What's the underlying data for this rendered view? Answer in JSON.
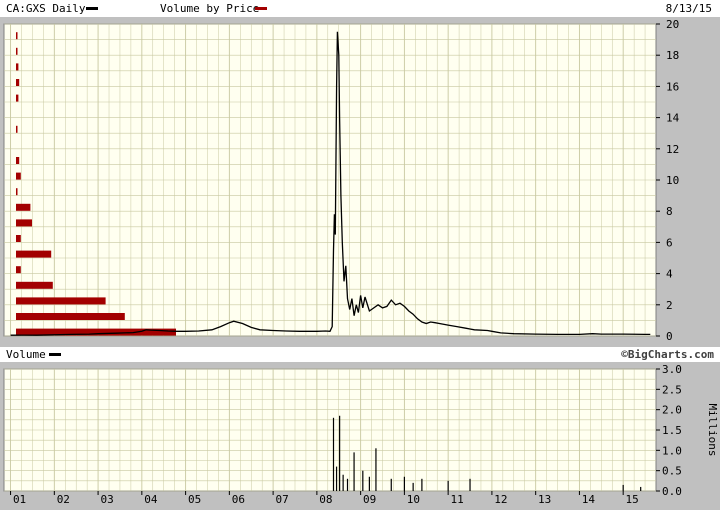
{
  "header": {
    "symbol_label": "CA:GXS Daily",
    "vbp_label": "Volume by Price",
    "date": "8/13/15"
  },
  "volume_header": {
    "label": "Volume",
    "watermark": "©BigCharts.com"
  },
  "colors": {
    "plot_bg": "#fffff0",
    "grid": "#c8c8a0",
    "frame_bg": "#c0c0c0",
    "price_line": "#000000",
    "vbp_bar": "#a30000"
  },
  "chart_data": [
    {
      "type": "line",
      "series": [
        {
          "name": "CA:GXS Daily",
          "x": [
            2001.0,
            2001.3,
            2001.6,
            2002.0,
            2002.4,
            2002.8,
            2003.0,
            2003.4,
            2003.6,
            2003.8,
            2004.0,
            2004.1,
            2004.2,
            2004.4,
            2004.6,
            2004.8,
            2005.0,
            2005.3,
            2005.6,
            2005.8,
            2006.0,
            2006.1,
            2006.3,
            2006.5,
            2006.7,
            2007.0,
            2007.3,
            2007.6,
            2008.0,
            2008.2,
            2008.3,
            2008.35,
            2008.38,
            2008.4,
            2008.42,
            2008.45,
            2008.47,
            2008.5,
            2008.52,
            2008.55,
            2008.58,
            2008.62,
            2008.66,
            2008.7,
            2008.75,
            2008.8,
            2008.85,
            2008.9,
            2008.95,
            2009.0,
            2009.05,
            2009.1,
            2009.2,
            2009.3,
            2009.4,
            2009.5,
            2009.6,
            2009.7,
            2009.8,
            2009.9,
            2010.0,
            2010.1,
            2010.2,
            2010.3,
            2010.4,
            2010.5,
            2010.6,
            2010.7,
            2010.8,
            2011.0,
            2011.2,
            2011.4,
            2011.5,
            2011.6,
            2011.9,
            2012.0,
            2012.2,
            2012.5,
            2013.0,
            2013.5,
            2014.0,
            2014.3,
            2014.5,
            2015.0,
            2015.5,
            2015.62
          ],
          "y": [
            0.05,
            0.06,
            0.05,
            0.08,
            0.1,
            0.12,
            0.15,
            0.18,
            0.2,
            0.22,
            0.3,
            0.4,
            0.38,
            0.35,
            0.32,
            0.3,
            0.3,
            0.32,
            0.4,
            0.6,
            0.85,
            0.95,
            0.8,
            0.55,
            0.4,
            0.35,
            0.32,
            0.3,
            0.3,
            0.32,
            0.3,
            0.6,
            5.5,
            7.8,
            6.5,
            16.0,
            19.5,
            18.0,
            14.0,
            9.0,
            6.0,
            3.5,
            4.5,
            2.4,
            1.7,
            2.4,
            1.3,
            2.0,
            1.5,
            2.6,
            1.8,
            2.5,
            1.6,
            1.8,
            2.0,
            1.8,
            1.9,
            2.3,
            2.0,
            2.1,
            1.9,
            1.6,
            1.4,
            1.1,
            0.9,
            0.8,
            0.9,
            0.85,
            0.8,
            0.7,
            0.6,
            0.5,
            0.45,
            0.4,
            0.35,
            0.3,
            0.2,
            0.15,
            0.12,
            0.1,
            0.1,
            0.15,
            0.12,
            0.12,
            0.1,
            0.1
          ]
        },
        {
          "name": "Volume by Price",
          "price_levels": [
            0.25,
            1.25,
            2.25,
            3.25,
            4.25,
            5.25,
            6.25,
            7.25,
            8.25,
            9.25,
            10.25,
            11.25,
            12.25,
            13.25,
            14.25,
            15.25,
            16.25,
            17.25,
            18.25,
            19.25
          ],
          "values": [
            100,
            68,
            56,
            23,
            3,
            22,
            3,
            10,
            9,
            0.8,
            3,
            2,
            0,
            0.8,
            0,
            1.5,
            2,
            1.5,
            0.5,
            0.8
          ]
        }
      ],
      "xaxis_ticks": [
        "01",
        "02",
        "03",
        "04",
        "05",
        "06",
        "07",
        "08",
        "09",
        "10",
        "11",
        "12",
        "13",
        "14",
        "15"
      ],
      "ylim": [
        0,
        20
      ],
      "yticks": [
        "0",
        "2",
        "4",
        "6",
        "8",
        "10",
        "12",
        "14",
        "16",
        "18",
        "20"
      ],
      "grid": true
    },
    {
      "type": "bar",
      "series": [
        {
          "name": "Volume",
          "x": [
            2008.38,
            2008.45,
            2008.52,
            2008.6,
            2008.7,
            2008.85,
            2009.05,
            2009.2,
            2009.35,
            2009.7,
            2010.0,
            2010.2,
            2010.4,
            2011.0,
            2011.5,
            2015.0,
            2015.4
          ],
          "y": [
            1.8,
            0.6,
            1.85,
            0.4,
            0.3,
            0.95,
            0.5,
            0.35,
            1.05,
            0.3,
            0.35,
            0.2,
            0.3,
            0.25,
            0.3,
            0.15,
            0.1
          ]
        }
      ],
      "ylim": [
        0,
        3.0
      ],
      "yticks": [
        "0.0",
        "0.5",
        "1.0",
        "1.5",
        "2.0",
        "2.5",
        "3.0"
      ],
      "ylabel": "Millions",
      "xaxis_ticks": [
        "01",
        "02",
        "03",
        "04",
        "05",
        "06",
        "07",
        "08",
        "09",
        "10",
        "11",
        "12",
        "13",
        "14",
        "15"
      ],
      "grid": true
    }
  ]
}
